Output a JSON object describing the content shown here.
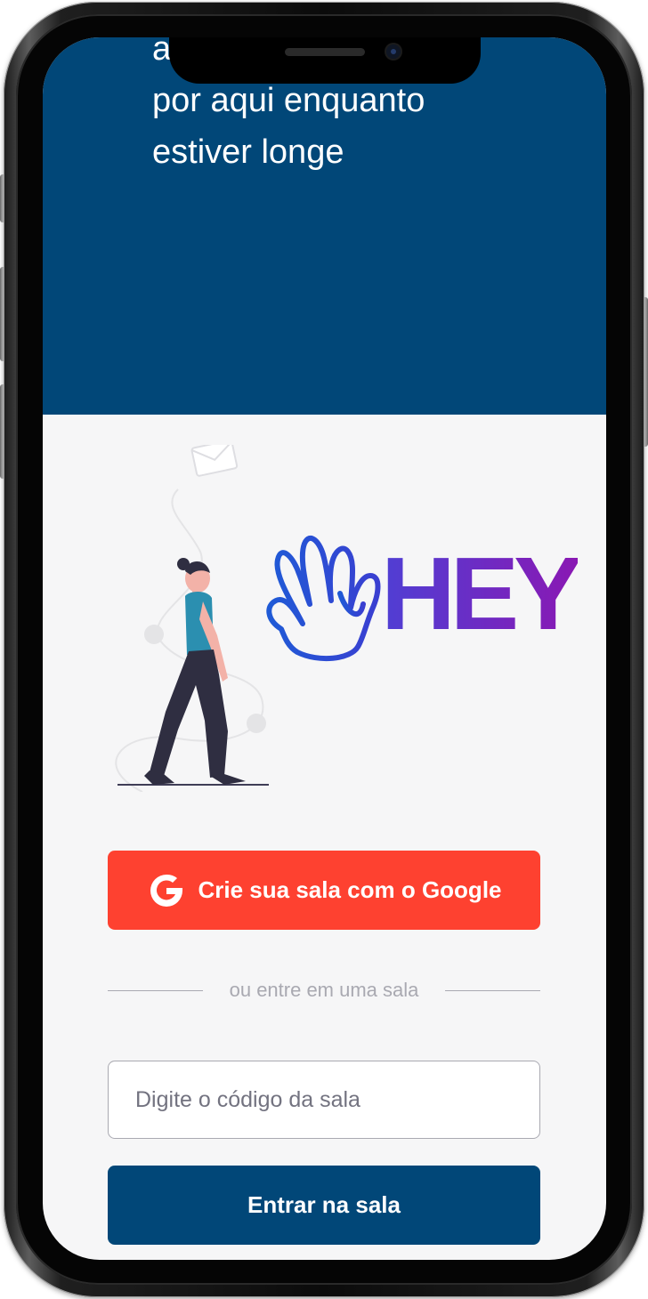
{
  "hero": {
    "lines": [
      "a",
      "por aqui enquanto",
      "estiver longe"
    ],
    "background": "#014778"
  },
  "logo": {
    "text": "HEY"
  },
  "actions": {
    "google_button_label": "Crie sua sala com o Google",
    "separator_text": "ou entre em uma sala",
    "room_code_placeholder": "Digite o código da sala",
    "enter_button_label": "Entrar na sala"
  },
  "colors": {
    "google_red": "#fe4130",
    "primary_blue": "#014778",
    "page_bg": "#f6f6f7",
    "muted_text": "#a9a9b1",
    "logo_gradient_start": "#4f3fd4",
    "logo_gradient_end": "#8a18b3"
  },
  "icons": [
    "google-icon",
    "envelope-icon",
    "wave-hand-icon"
  ]
}
